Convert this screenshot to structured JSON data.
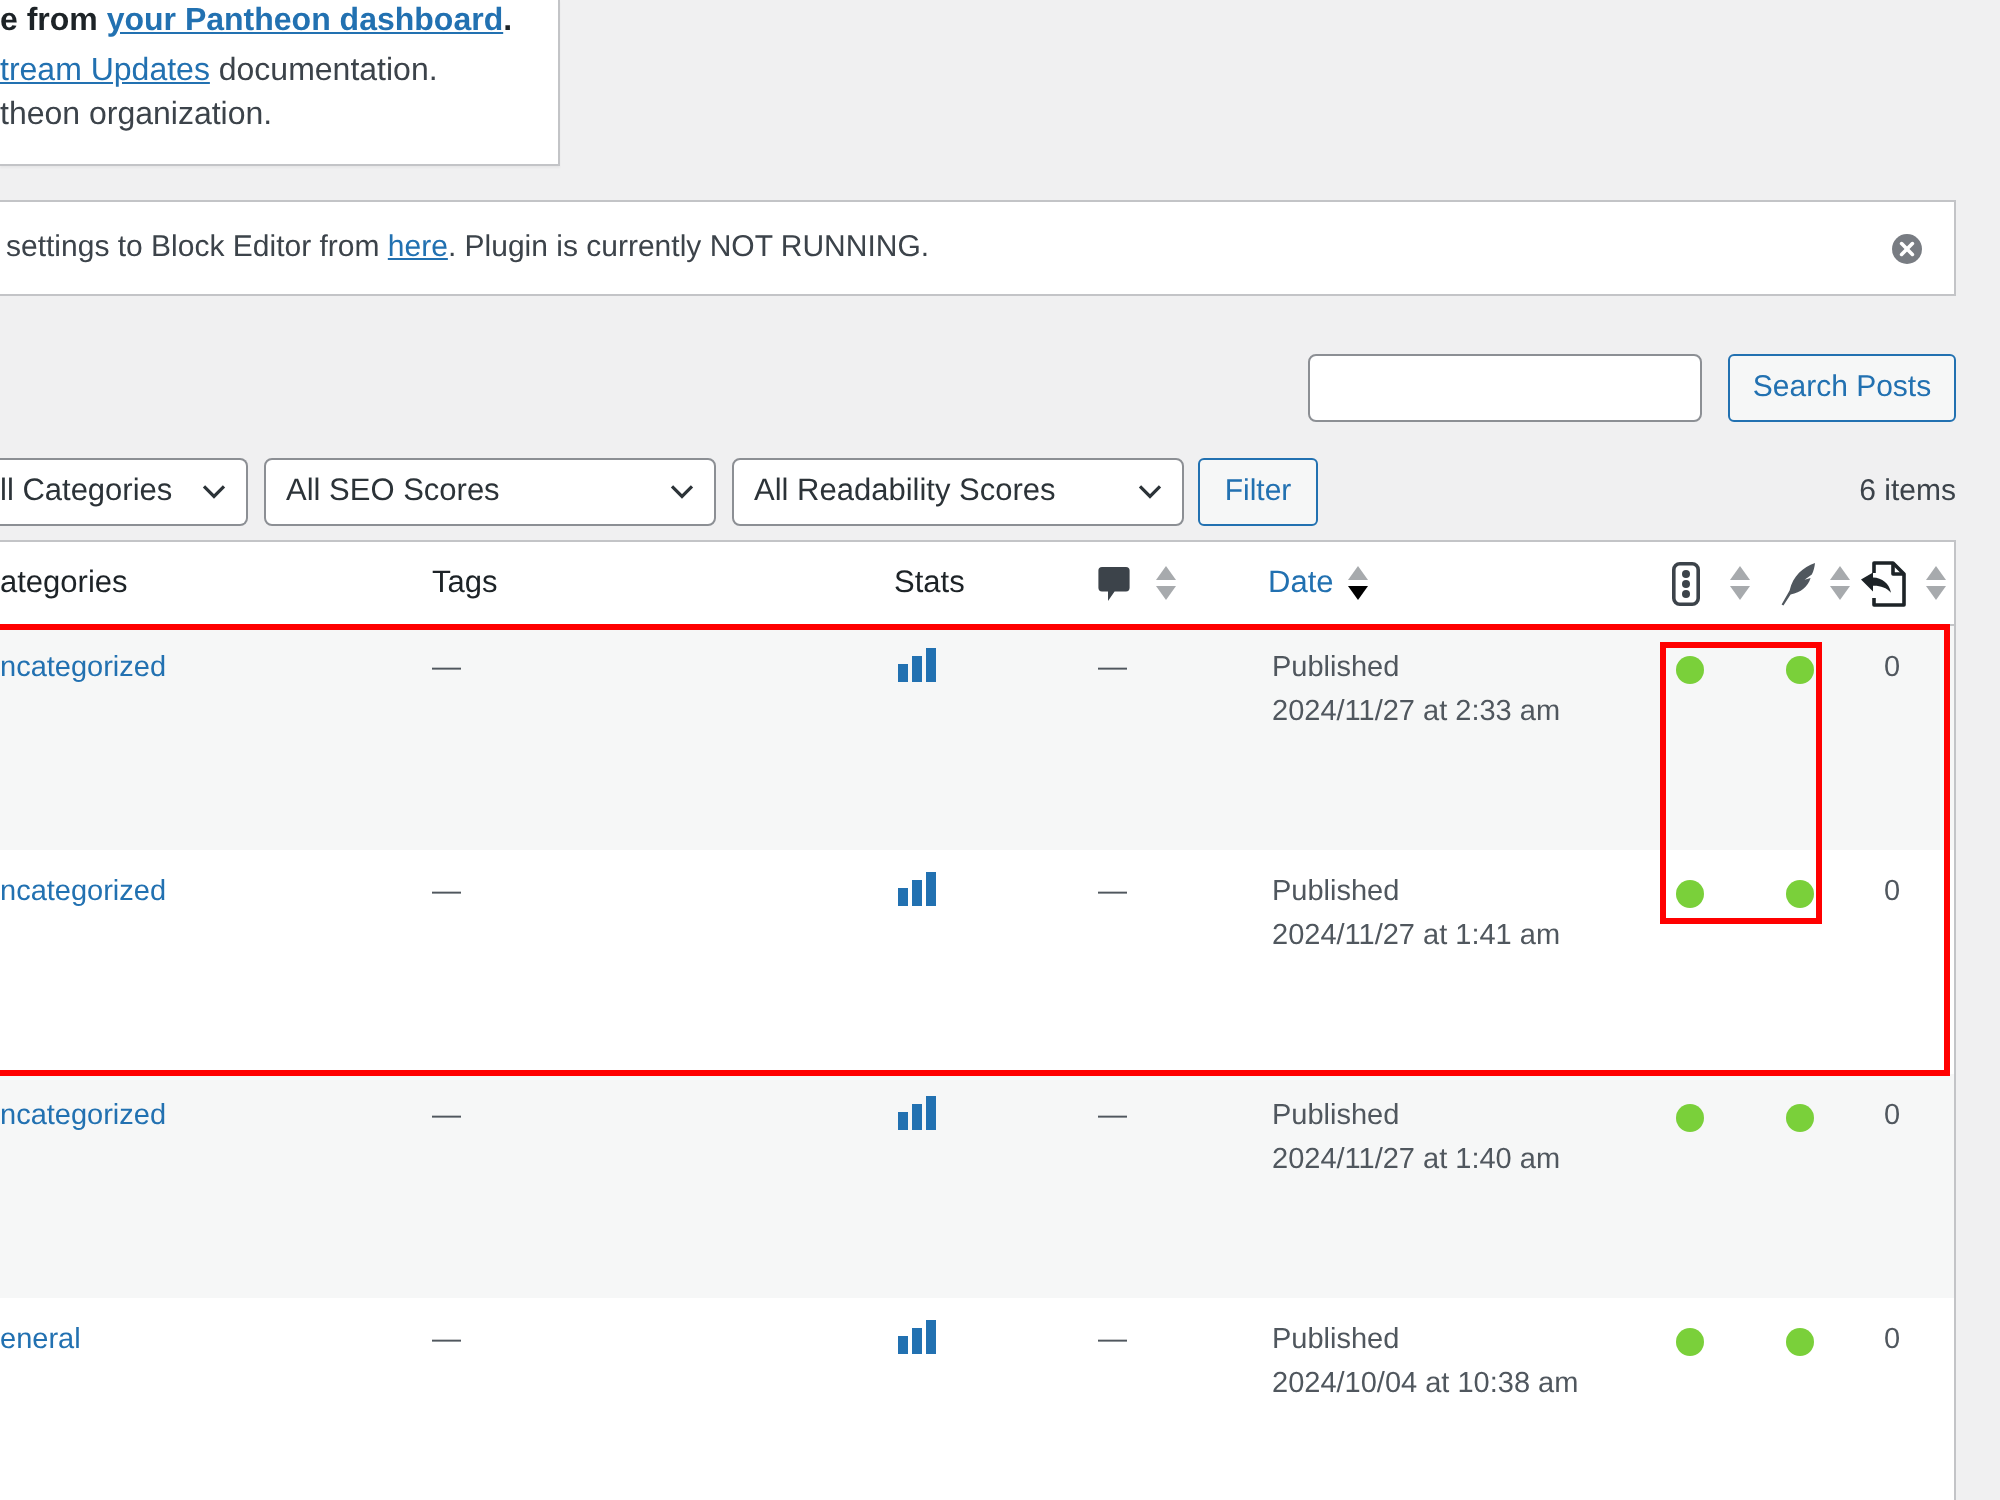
{
  "pantheon_notice": {
    "paragraphs": [
      {
        "bold": true,
        "lines": [
          [
            {
              "kind": "text",
              "text": "e from "
            },
            {
              "kind": "link",
              "text": "your Pantheon dashboard"
            },
            {
              "kind": "text",
              "text": "."
            }
          ]
        ]
      },
      {
        "bold": false,
        "lines": [
          [
            {
              "kind": "link",
              "text": "tream Updates"
            },
            {
              "kind": "text",
              "text": " documentation."
            }
          ],
          [
            {
              "kind": "text",
              "text": "theon organization."
            }
          ]
        ]
      }
    ]
  },
  "editor_notice": {
    "segments": [
      {
        "kind": "text",
        "text": "settings to Block Editor from "
      },
      {
        "kind": "link",
        "text": "here"
      },
      {
        "kind": "text",
        "text": ". Plugin is currently NOT RUNNING."
      }
    ],
    "dismissible": true
  },
  "search": {
    "button": "Search Posts"
  },
  "filters": {
    "dropdowns": [
      {
        "value": "ll Categories"
      },
      {
        "value": "All SEO Scores"
      },
      {
        "value": "All Readability Scores"
      }
    ],
    "button": "Filter",
    "count": "6 items"
  },
  "table": {
    "columns": [
      {
        "kind": "text",
        "label": "ategories",
        "sortable": false
      },
      {
        "kind": "text",
        "label": "Tags",
        "sortable": false
      },
      {
        "kind": "text",
        "label": "Stats",
        "sortable": false
      },
      {
        "kind": "comments",
        "sortable": true,
        "sorted": false
      },
      {
        "kind": "text",
        "label": "Date",
        "sortable": true,
        "sorted": true
      },
      {
        "kind": "seo",
        "sortable": true,
        "sorted": false
      },
      {
        "kind": "readability",
        "sortable": true,
        "sorted": false
      },
      {
        "kind": "links",
        "sortable": true,
        "sorted": false
      }
    ],
    "rows": [
      {
        "category": "ncategorized",
        "tags": "—",
        "comments": "—",
        "status": "Published",
        "date": "2024/11/27 at 2:33 am",
        "scores": [
          {
            "kind": "seo",
            "color": "#7ad03a"
          },
          {
            "kind": "readability",
            "color": "#7ad03a"
          }
        ],
        "inbound_links": "0",
        "framed": true
      },
      {
        "category": "ncategorized",
        "tags": "—",
        "comments": "—",
        "status": "Published",
        "date": "2024/11/27 at 1:41 am",
        "scores": [
          {
            "kind": "seo",
            "color": "#7ad03a"
          },
          {
            "kind": "readability",
            "color": "#7ad03a"
          }
        ],
        "inbound_links": "0",
        "framed": true
      },
      {
        "category": "ncategorized",
        "tags": "—",
        "comments": "—",
        "status": "Published",
        "date": "2024/11/27 at 1:40 am",
        "scores": [
          {
            "kind": "seo",
            "color": "#7ad03a"
          },
          {
            "kind": "readability",
            "color": "#7ad03a"
          }
        ],
        "inbound_links": "0",
        "framed": false
      },
      {
        "category": "eneral",
        "tags": "—",
        "comments": "—",
        "status": "Published",
        "date": "2024/10/04 at 10:38 am",
        "scores": [
          {
            "kind": "seo",
            "color": "#7ad03a"
          },
          {
            "kind": "readability",
            "color": "#7ad03a"
          }
        ],
        "inbound_links": "0",
        "framed": false
      }
    ]
  }
}
